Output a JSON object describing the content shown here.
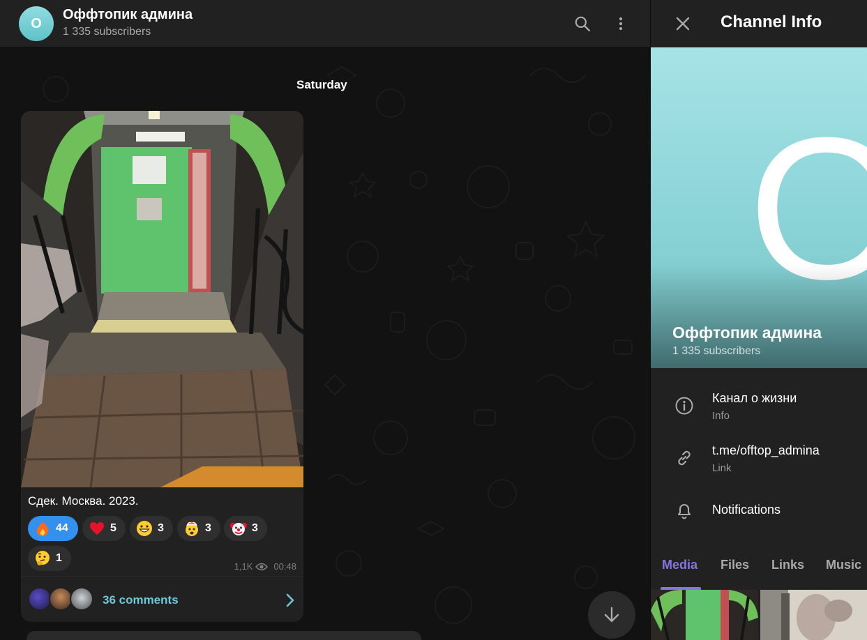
{
  "chat": {
    "avatar_letter": "O",
    "title": "Оффтопик админа",
    "subscribers": "1 335 subscribers",
    "date_separator": "Saturday"
  },
  "message": {
    "caption": "Сдек. Москва. 2023.",
    "reactions": [
      {
        "emoji": "fire-emoji",
        "count": "44",
        "chosen": true
      },
      {
        "emoji": "red-heart-emoji",
        "count": "5",
        "chosen": false
      },
      {
        "emoji": "grinning-face-emoji",
        "count": "3",
        "chosen": false
      },
      {
        "emoji": "exploding-head-emoji",
        "count": "3",
        "chosen": false
      },
      {
        "emoji": "clown-face-emoji",
        "count": "3",
        "chosen": false
      },
      {
        "emoji": "thinking-face-emoji",
        "count": "1",
        "chosen": false
      }
    ],
    "views": "1,1K",
    "time": "00:48",
    "comments_label": "36 comments"
  },
  "info_panel": {
    "title": "Channel Info",
    "cover_letter": "O",
    "name": "Оффтопик админа",
    "subscribers": "1 335 subscribers",
    "rows": [
      {
        "icon": "info-icon",
        "primary": "Канал о жизни",
        "secondary": "Info"
      },
      {
        "icon": "link-icon",
        "primary": "t.me/offtop_admina",
        "secondary": "Link"
      },
      {
        "icon": "bell-icon",
        "primary": "Notifications",
        "secondary": ""
      }
    ],
    "tabs": [
      "Media",
      "Files",
      "Links",
      "Music"
    ],
    "active_tab": "Media"
  },
  "colors": {
    "accent_blue": "#3390ec",
    "accent_purple": "#8774e1",
    "comments_link": "#6fc8d8",
    "avatar_teal": "#8fdde0",
    "background": "#121212",
    "surface": "#212121"
  }
}
